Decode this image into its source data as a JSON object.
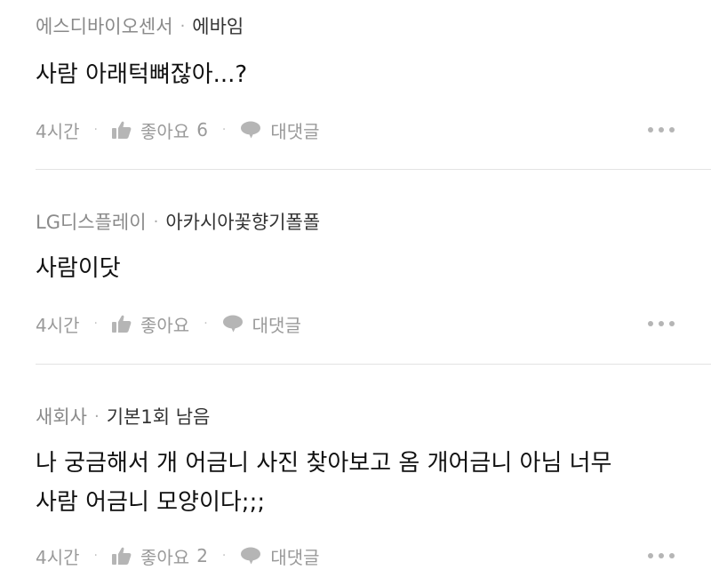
{
  "comments": [
    {
      "company": "에스디바이오센서",
      "separator": "·",
      "nickname": "에바임",
      "body_lines": [
        "사람 아래턱뼈잖아...?"
      ],
      "time": "4시간",
      "like_label": "좋아요",
      "like_count": "6",
      "reply_label": "대댓글",
      "more_icon": "more-dots-icon"
    },
    {
      "company": "LG디스플레이",
      "separator": "·",
      "nickname": "아카시아꽃향기폴폴",
      "body_lines": [
        "사람이닷"
      ],
      "time": "4시간",
      "like_label": "좋아요",
      "like_count": "",
      "reply_label": "대댓글",
      "more_icon": "more-dots-icon"
    },
    {
      "company": "새회사",
      "separator": "·",
      "nickname": "기본1회 남음",
      "body_lines": [
        "나 궁금해서 개 어금니 사진 찾아보고 옴 개어금니 아님 너무",
        "사람 어금니 모양이다;;;"
      ],
      "time": "4시간",
      "like_label": "좋아요",
      "like_count": "2",
      "reply_label": "대댓글",
      "more_icon": "more-dots-icon"
    }
  ],
  "icons": {
    "like": "thumbs-up-icon",
    "reply": "speech-bubble-icon",
    "more": "more-dots-icon"
  },
  "colors": {
    "meta_gray": "#8a8a8a",
    "action_gray": "#9a9a9a",
    "divider": "#e3e3e3"
  }
}
